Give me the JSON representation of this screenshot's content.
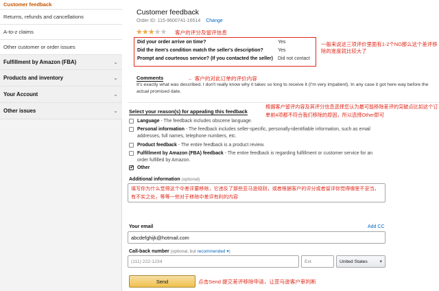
{
  "sidebar": {
    "items": [
      {
        "label": "Customer feedback"
      },
      {
        "label": "Returns, refunds and cancellations"
      },
      {
        "label": "A-to-z claims"
      },
      {
        "label": "Other customer or order issues"
      }
    ],
    "sections": [
      {
        "label": "Fulfillment by Amazon (FBA)"
      },
      {
        "label": "Products and inventory"
      },
      {
        "label": "Your Account"
      },
      {
        "label": "Other issues"
      }
    ]
  },
  "header": {
    "title": "Customer feedback",
    "order_id": "Order ID: 115-9600741-16514",
    "change_link": "Change"
  },
  "rating": {
    "stars": 3,
    "max": 5,
    "annotation": "客户的评分及留评信息"
  },
  "questions": [
    {
      "q": "Did your order arrive on time?",
      "a": "Yes"
    },
    {
      "q": "Did the item's condition match the seller's description?",
      "a": "Yes"
    },
    {
      "q": "Prompt and courteous service? (If you contacted the seller)",
      "a": "Did not contact"
    }
  ],
  "questions_annotation": "一般来说这三项评价里面有1-2个NO那么这个差评移除的准度就比较大了",
  "comments": {
    "label": "Comments",
    "annotation": "客户的对此订单的评价内容",
    "text": "It's exactly what was described. I don't really know why it takes so long to receive it (I'm very impatient). In any case it got here way before the actual promised date."
  },
  "reasons": {
    "title": "Select your reason(s) for appealing this feedback",
    "annotation": "根据客户留评内容及其评分信息选择您认为最可能移除差评的突破点比如这个订单前4项都不符合我们移除的原因，所以选择Other即可",
    "options": [
      {
        "name": "Language",
        "desc": " - The feedback includes obscene language.",
        "checked": false
      },
      {
        "name": "Personal information",
        "desc": " - The feedback includes seller-specific, personally-identifiable information, such as email addresses, full names, telephone numbers, etc.",
        "checked": false
      },
      {
        "name": "Product feedback",
        "desc": " - The entire feedback is a product review.",
        "checked": false
      },
      {
        "name": "Fulfillment by Amazon (FBA) feedback",
        "desc": " - The entire feedback is regarding fulfillment or customer service for an order fulfilled by Amazon.",
        "checked": false
      },
      {
        "name": "Other",
        "desc": "",
        "checked": true
      }
    ]
  },
  "additional": {
    "label": "Additional information",
    "optional": "(optional)",
    "value": "填写你为什么觉得这个中差评要移除，它违反了那些亚马逊规则，或者根据客户的评分或者留评你觉得哪里不妥当，有不实之处，等等一些对于移除中差评有利的内容"
  },
  "email": {
    "label": "Your email",
    "add_cc": "Add CC",
    "value": "abcdefghijk@hotmail.com"
  },
  "callback": {
    "label": "Call-back number",
    "optional": "(optional, but",
    "recommended": "recommended",
    "close": ")",
    "phone_placeholder": "(111) 222-1234",
    "ext_placeholder": "Ext.",
    "country": "United States"
  },
  "send": {
    "label": "Send",
    "annotation": "点击Send 提交差评移除申请，让亚马逊客户审判断"
  },
  "colors": {
    "annotation_red": "#e0281a",
    "link_blue": "#0066c0",
    "active_orange": "#c45500",
    "star_gold": "#f3a847",
    "button_gold": "#f0c14b"
  }
}
